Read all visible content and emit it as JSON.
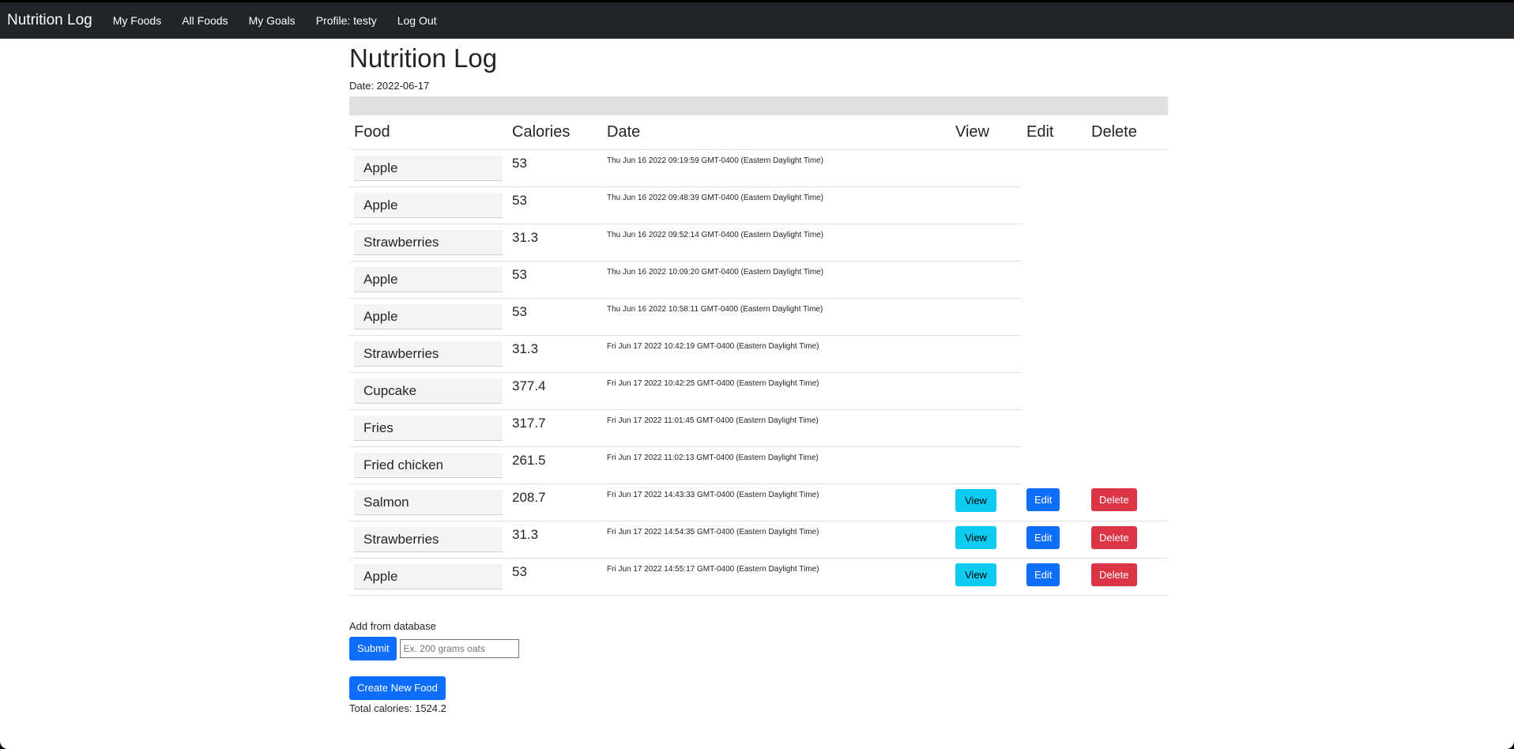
{
  "nav": {
    "brand": "Nutrition Log",
    "links": [
      "My Foods",
      "All Foods",
      "My Goals",
      "Profile: testy",
      "Log Out"
    ]
  },
  "page": {
    "title": "Nutrition Log",
    "date_line": "Date: 2022-06-17"
  },
  "table": {
    "headers": [
      "Food",
      "Calories",
      "Date",
      "View",
      "Edit",
      "Delete"
    ],
    "rows": [
      {
        "food": "Apple",
        "calories": "53",
        "date": "Thu Jun 16 2022 09:19:59 GMT-0400 (Eastern Daylight Time)",
        "actions": false
      },
      {
        "food": "Apple",
        "calories": "53",
        "date": "Thu Jun 16 2022 09:48:39 GMT-0400 (Eastern Daylight Time)",
        "actions": false
      },
      {
        "food": "Strawberries",
        "calories": "31.3",
        "date": "Thu Jun 16 2022 09:52:14 GMT-0400 (Eastern Daylight Time)",
        "actions": false
      },
      {
        "food": "Apple",
        "calories": "53",
        "date": "Thu Jun 16 2022 10:09:20 GMT-0400 (Eastern Daylight Time)",
        "actions": false
      },
      {
        "food": "Apple",
        "calories": "53",
        "date": "Thu Jun 16 2022 10:58:11 GMT-0400 (Eastern Daylight Time)",
        "actions": false
      },
      {
        "food": "Strawberries",
        "calories": "31.3",
        "date": "Fri Jun 17 2022 10:42:19 GMT-0400 (Eastern Daylight Time)",
        "actions": false
      },
      {
        "food": "Cupcake",
        "calories": "377.4",
        "date": "Fri Jun 17 2022 10:42:25 GMT-0400 (Eastern Daylight Time)",
        "actions": false
      },
      {
        "food": "Fries",
        "calories": "317.7",
        "date": "Fri Jun 17 2022 11:01:45 GMT-0400 (Eastern Daylight Time)",
        "actions": false
      },
      {
        "food": "Fried chicken",
        "calories": "261.5",
        "date": "Fri Jun 17 2022 11:02:13 GMT-0400 (Eastern Daylight Time)",
        "actions": false
      },
      {
        "food": "Salmon",
        "calories": "208.7",
        "date": "Fri Jun 17 2022 14:43:33 GMT-0400 (Eastern Daylight Time)",
        "actions": true
      },
      {
        "food": "Strawberries",
        "calories": "31.3",
        "date": "Fri Jun 17 2022 14:54:35 GMT-0400 (Eastern Daylight Time)",
        "actions": true
      },
      {
        "food": "Apple",
        "calories": "53",
        "date": "Fri Jun 17 2022 14:55:17 GMT-0400 (Eastern Daylight Time)",
        "actions": true
      }
    ],
    "buttons": {
      "view": "View",
      "edit": "Edit",
      "delete": "Delete"
    }
  },
  "add_form": {
    "label": "Add from database",
    "submit_label": "Submit",
    "placeholder": "Ex. 200 grams oats",
    "value": ""
  },
  "create_label": "Create New Food",
  "total_line": "Total calories: 1524.2",
  "colors": {
    "navbar": "#212529",
    "primary": "#0d6efd",
    "info": "#0dcaf0",
    "danger": "#dc3545"
  }
}
